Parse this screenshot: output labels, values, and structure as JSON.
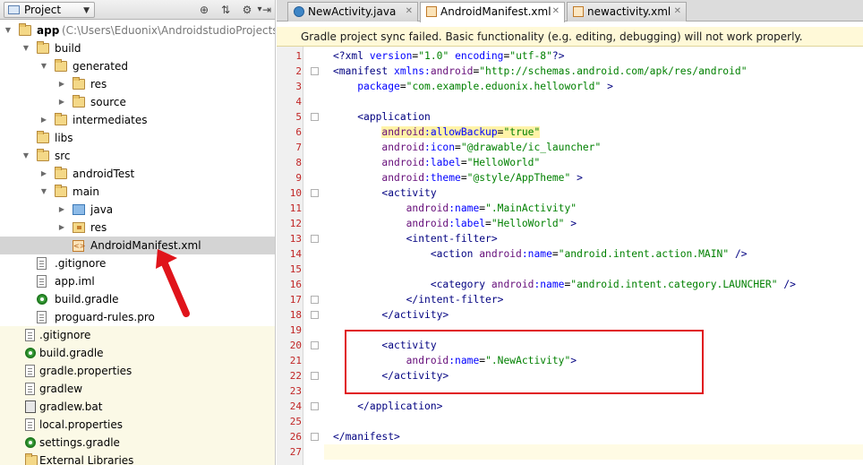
{
  "project_panel": {
    "view_label": "Project",
    "tree": [
      {
        "label": "app",
        "path": " (C:\\Users\\Eduonix\\AndroidstudioProjects\\Hell",
        "icon": "module-folder-icon",
        "depth": 0,
        "expanded": true,
        "bold": true
      },
      {
        "label": "build",
        "icon": "folder-icon",
        "depth": 1,
        "expanded": true
      },
      {
        "label": "generated",
        "icon": "folder-icon",
        "depth": 2,
        "expanded": true
      },
      {
        "label": "res",
        "icon": "folder-icon",
        "depth": 3,
        "expanded": false
      },
      {
        "label": "source",
        "icon": "folder-icon",
        "depth": 3,
        "expanded": false
      },
      {
        "label": "intermediates",
        "icon": "folder-icon",
        "depth": 2,
        "expanded": false
      },
      {
        "label": "libs",
        "icon": "folder-icon",
        "depth": 1
      },
      {
        "label": "src",
        "icon": "folder-icon",
        "depth": 1,
        "expanded": true
      },
      {
        "label": "androidTest",
        "icon": "folder-icon",
        "depth": 2,
        "expanded": false
      },
      {
        "label": "main",
        "icon": "folder-icon",
        "depth": 2,
        "expanded": true
      },
      {
        "label": "java",
        "icon": "source-folder-icon",
        "depth": 3,
        "expanded": false
      },
      {
        "label": "res",
        "icon": "resource-folder-icon",
        "depth": 3,
        "expanded": false
      },
      {
        "label": "AndroidManifest.xml",
        "icon": "xml-file-icon",
        "depth": 3,
        "selected": true
      },
      {
        "label": ".gitignore",
        "icon": "text-file-icon",
        "depth": 1
      },
      {
        "label": "app.iml",
        "icon": "iml-file-icon",
        "depth": 1
      },
      {
        "label": "build.gradle",
        "icon": "gradle-file-icon",
        "depth": 1
      },
      {
        "label": "proguard-rules.pro",
        "icon": "text-file-icon",
        "depth": 1
      },
      {
        "label": ".gitignore",
        "icon": "text-file-icon",
        "depth": 0,
        "root": true
      },
      {
        "label": "build.gradle",
        "icon": "gradle-file-icon",
        "depth": 0,
        "root": true
      },
      {
        "label": "gradle.properties",
        "icon": "text-file-icon",
        "depth": 0,
        "root": true
      },
      {
        "label": "gradlew",
        "icon": "text-file-icon",
        "depth": 0,
        "root": true
      },
      {
        "label": "gradlew.bat",
        "icon": "bat-file-icon",
        "depth": 0,
        "root": true
      },
      {
        "label": "local.properties",
        "icon": "text-file-icon",
        "depth": 0,
        "root": true
      },
      {
        "label": "settings.gradle",
        "icon": "gradle-file-icon",
        "depth": 0,
        "root": true
      },
      {
        "label": "External Libraries",
        "icon": "libraries-icon",
        "depth": 0,
        "root": true
      }
    ]
  },
  "editor": {
    "tabs": [
      {
        "label": "NewActivity.java",
        "icon": "java-class-icon",
        "active": false
      },
      {
        "label": "AndroidManifest.xml",
        "icon": "manifest-icon",
        "active": true
      },
      {
        "label": "newactivity.xml",
        "icon": "layout-xml-icon",
        "active": false
      }
    ],
    "notification": "Gradle project sync failed. Basic functionality (e.g. editing, debugging) will not work properly.",
    "lines": [
      {
        "n": "1",
        "tokens": [
          [
            "tag",
            "<?xml "
          ],
          [
            "attr",
            "version"
          ],
          [
            "plain",
            "="
          ],
          [
            "str",
            "\"1.0\""
          ],
          [
            "plain",
            " "
          ],
          [
            "attr",
            "encoding"
          ],
          [
            "plain",
            "="
          ],
          [
            "str",
            "\"utf-8\""
          ],
          [
            "tag",
            "?>"
          ]
        ]
      },
      {
        "n": "2",
        "tokens": [
          [
            "tag",
            "<manifest "
          ],
          [
            "attr",
            "xmlns:"
          ],
          [
            "ns",
            "android"
          ],
          [
            "plain",
            "="
          ],
          [
            "str",
            "\"http://schemas.android.com/apk/res/android\""
          ]
        ]
      },
      {
        "n": "3",
        "tokens": [
          [
            "plain",
            "    "
          ],
          [
            "attr",
            "package"
          ],
          [
            "plain",
            "="
          ],
          [
            "str",
            "\"com.example.eduonix.helloworld\""
          ],
          [
            "plain",
            " "
          ],
          [
            "tag",
            ">"
          ]
        ]
      },
      {
        "n": "4",
        "tokens": []
      },
      {
        "n": "5",
        "tokens": [
          [
            "plain",
            "    "
          ],
          [
            "tag",
            "<application"
          ]
        ]
      },
      {
        "n": "6",
        "tokens": [
          [
            "plain",
            "        "
          ],
          [
            "nshl",
            "android"
          ],
          [
            "attrhl",
            ":allowBackup"
          ],
          [
            "plainhl",
            "="
          ],
          [
            "strhl",
            "\"true\""
          ]
        ]
      },
      {
        "n": "7",
        "tokens": [
          [
            "plain",
            "        "
          ],
          [
            "ns",
            "android"
          ],
          [
            "attr",
            ":icon"
          ],
          [
            "plain",
            "="
          ],
          [
            "str",
            "\"@drawable/ic_launcher\""
          ]
        ]
      },
      {
        "n": "8",
        "tokens": [
          [
            "plain",
            "        "
          ],
          [
            "ns",
            "android"
          ],
          [
            "attr",
            ":label"
          ],
          [
            "plain",
            "="
          ],
          [
            "str",
            "\"HelloWorld\""
          ]
        ]
      },
      {
        "n": "9",
        "tokens": [
          [
            "plain",
            "        "
          ],
          [
            "ns",
            "android"
          ],
          [
            "attr",
            ":theme"
          ],
          [
            "plain",
            "="
          ],
          [
            "str",
            "\"@style/AppTheme\""
          ],
          [
            "plain",
            " "
          ],
          [
            "tag",
            ">"
          ]
        ]
      },
      {
        "n": "10",
        "tokens": [
          [
            "plain",
            "        "
          ],
          [
            "tag",
            "<activity"
          ]
        ]
      },
      {
        "n": "11",
        "tokens": [
          [
            "plain",
            "            "
          ],
          [
            "ns",
            "android"
          ],
          [
            "attr",
            ":name"
          ],
          [
            "plain",
            "="
          ],
          [
            "str",
            "\".MainActivity\""
          ]
        ]
      },
      {
        "n": "12",
        "tokens": [
          [
            "plain",
            "            "
          ],
          [
            "ns",
            "android"
          ],
          [
            "attr",
            ":label"
          ],
          [
            "plain",
            "="
          ],
          [
            "str",
            "\"HelloWorld\""
          ],
          [
            "plain",
            " "
          ],
          [
            "tag",
            ">"
          ]
        ]
      },
      {
        "n": "13",
        "tokens": [
          [
            "plain",
            "            "
          ],
          [
            "tag",
            "<intent-filter>"
          ]
        ]
      },
      {
        "n": "14",
        "tokens": [
          [
            "plain",
            "                "
          ],
          [
            "tag",
            "<action "
          ],
          [
            "ns",
            "android"
          ],
          [
            "attr",
            ":name"
          ],
          [
            "plain",
            "="
          ],
          [
            "str",
            "\"android.intent.action.MAIN\""
          ],
          [
            "plain",
            " "
          ],
          [
            "tag",
            "/>"
          ]
        ]
      },
      {
        "n": "15",
        "tokens": []
      },
      {
        "n": "16",
        "tokens": [
          [
            "plain",
            "                "
          ],
          [
            "tag",
            "<category "
          ],
          [
            "ns",
            "android"
          ],
          [
            "attr",
            ":name"
          ],
          [
            "plain",
            "="
          ],
          [
            "str",
            "\"android.intent.category.LAUNCHER\""
          ],
          [
            "plain",
            " "
          ],
          [
            "tag",
            "/>"
          ]
        ]
      },
      {
        "n": "17",
        "tokens": [
          [
            "plain",
            "            "
          ],
          [
            "tag",
            "</intent-filter>"
          ]
        ]
      },
      {
        "n": "18",
        "tokens": [
          [
            "plain",
            "        "
          ],
          [
            "tag",
            "</activity>"
          ]
        ]
      },
      {
        "n": "19",
        "tokens": []
      },
      {
        "n": "20",
        "tokens": [
          [
            "plain",
            "        "
          ],
          [
            "tag",
            "<activity"
          ]
        ]
      },
      {
        "n": "21",
        "tokens": [
          [
            "plain",
            "            "
          ],
          [
            "ns",
            "android"
          ],
          [
            "attr",
            ":name"
          ],
          [
            "plain",
            "="
          ],
          [
            "str",
            "\".NewActivity\""
          ],
          [
            "tag",
            ">"
          ]
        ]
      },
      {
        "n": "22",
        "tokens": [
          [
            "plain",
            "        "
          ],
          [
            "tag",
            "</activity>"
          ]
        ]
      },
      {
        "n": "23",
        "tokens": []
      },
      {
        "n": "24",
        "tokens": [
          [
            "plain",
            "    "
          ],
          [
            "tag",
            "</application>"
          ]
        ]
      },
      {
        "n": "25",
        "tokens": []
      },
      {
        "n": "26",
        "tokens": [
          [
            "tag",
            "</manifest>"
          ]
        ]
      },
      {
        "n": "27",
        "tokens": [],
        "current": true
      }
    ]
  },
  "colors": {
    "line_number": "#c12525",
    "annotation_red": "#e0141b",
    "notification_bg": "#fff9d8"
  }
}
